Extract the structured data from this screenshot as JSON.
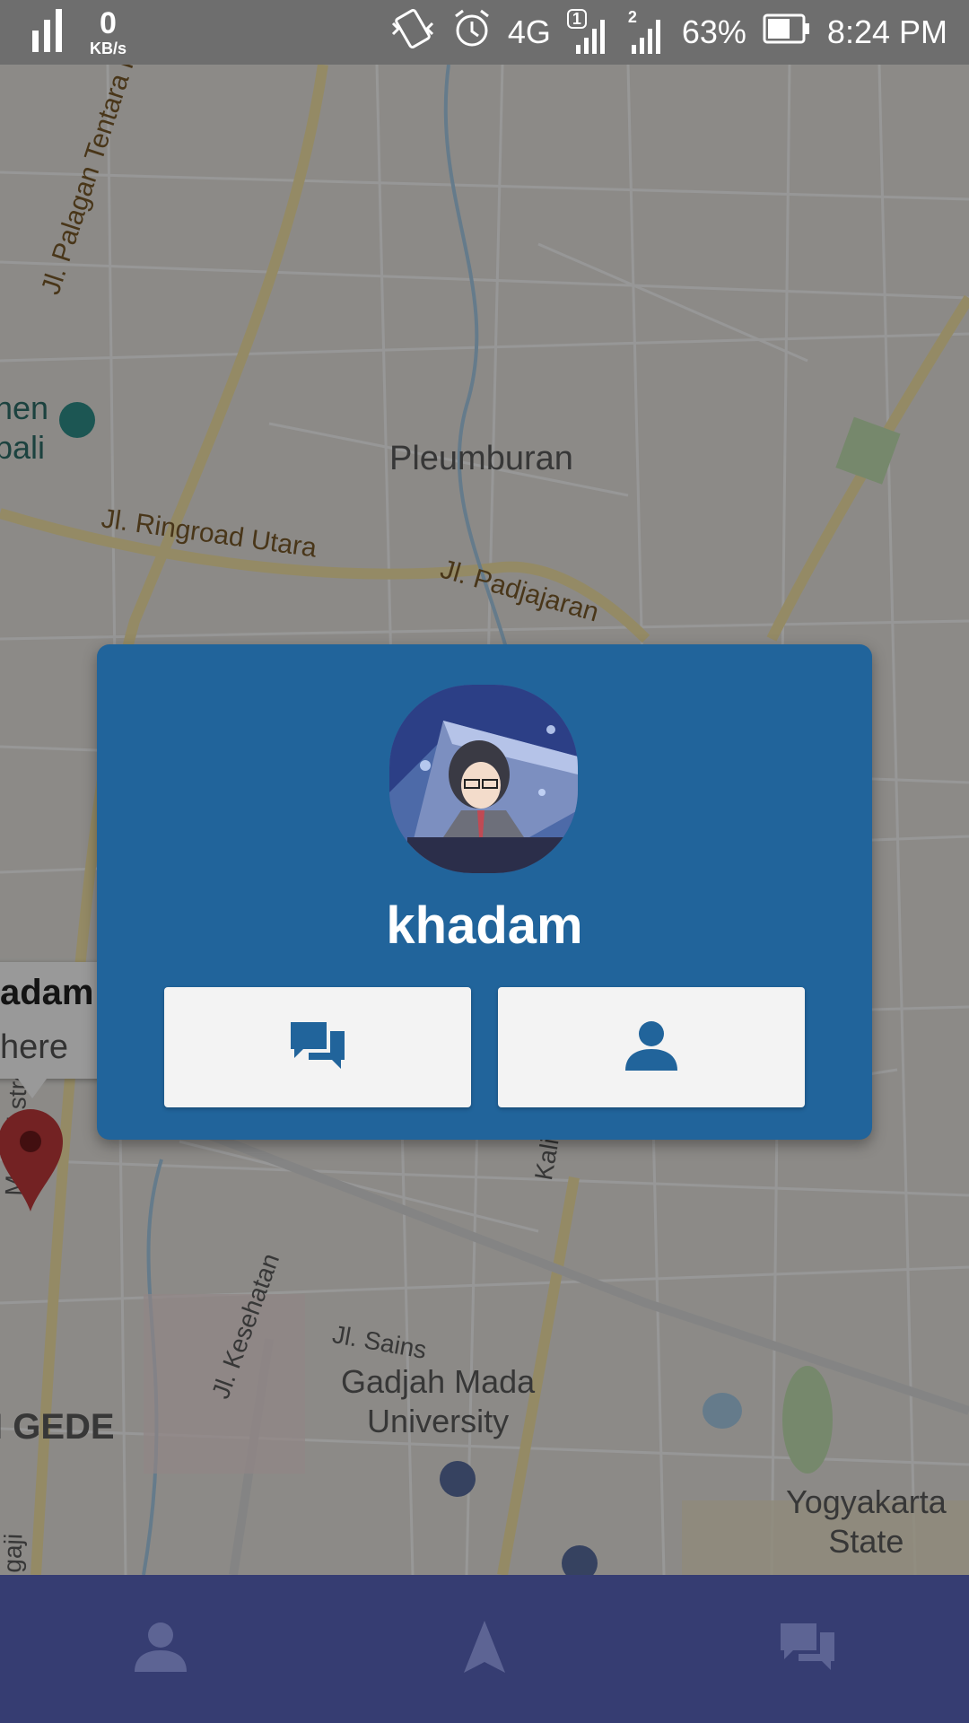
{
  "status_bar": {
    "net_speed_value": "0",
    "net_speed_unit": "KB/s",
    "network_type": "4G",
    "sim1_label": "1",
    "sim2_label": "2",
    "battery_percent": "63%",
    "time": "8:24 PM",
    "icons": [
      "signal-bars-icon",
      "vibrate-icon",
      "alarm-icon",
      "signal-sim1-icon",
      "signal-sim2-icon",
      "battery-icon"
    ]
  },
  "map": {
    "labels": {
      "area_pleumburan": "Pleumburan",
      "road_palagan": "Jl. Palagan Tentara Pelajar",
      "road_ringroad": "Jl. Ringroad Utara",
      "road_padjajaran": "Jl. Padjajaran",
      "road_monjali": "Monjali street",
      "road_kesehatan": "Jl. Kesehatan",
      "road_sains": "Jl. Sains",
      "road_kali": "Kali",
      "poi_ugm": "Gadjah Mada\nUniversity",
      "poi_uny": "Yogyakarta\nState",
      "poi_partial_1": "hen",
      "poi_partial_2": "bali",
      "area_gede": "I GEDE",
      "road_partial_left": "gaji"
    },
    "info_window": {
      "title": "adam",
      "snippet": "here"
    }
  },
  "dialog": {
    "username": "khadam",
    "chat_button_icon": "chat-icon",
    "profile_button_icon": "person-icon"
  },
  "bottom_nav": {
    "items": [
      {
        "icon": "person-icon"
      },
      {
        "icon": "navigation-arrow-icon"
      },
      {
        "icon": "chat-icon"
      }
    ]
  },
  "colors": {
    "dialog_bg": "#21649b",
    "bottom_nav_bg": "#363d72",
    "status_bar_bg": "#6e6e6e",
    "button_bg": "#f3f3f3",
    "marker_red": "#c0393b"
  }
}
